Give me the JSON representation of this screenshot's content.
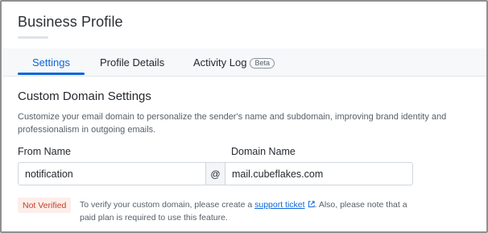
{
  "page": {
    "title": "Business Profile"
  },
  "tabs": [
    {
      "label": "Settings",
      "active": true
    },
    {
      "label": "Profile Details",
      "active": false
    },
    {
      "label": "Activity Log",
      "badge": "Beta",
      "active": false
    }
  ],
  "section": {
    "title": "Custom Domain Settings",
    "description": "Customize your email domain to personalize the sender's name and subdomain, improving brand identity and professionalism in outgoing emails."
  },
  "form": {
    "from_label": "From Name",
    "from_value": "notification",
    "at_symbol": "@",
    "domain_label": "Domain Name",
    "domain_value": "mail.cubeflakes.com"
  },
  "verification": {
    "status": "Not Verified",
    "notice_prefix": "To verify your custom domain, please create a ",
    "link_text": "support ticket",
    "notice_suffix": ". Also, please note that a paid plan is required to use this feature."
  },
  "colors": {
    "accent": "#0b66d9",
    "status_text": "#c2402a",
    "status_bg": "#fdeee9"
  },
  "icons": {
    "link": "external-link-icon"
  }
}
